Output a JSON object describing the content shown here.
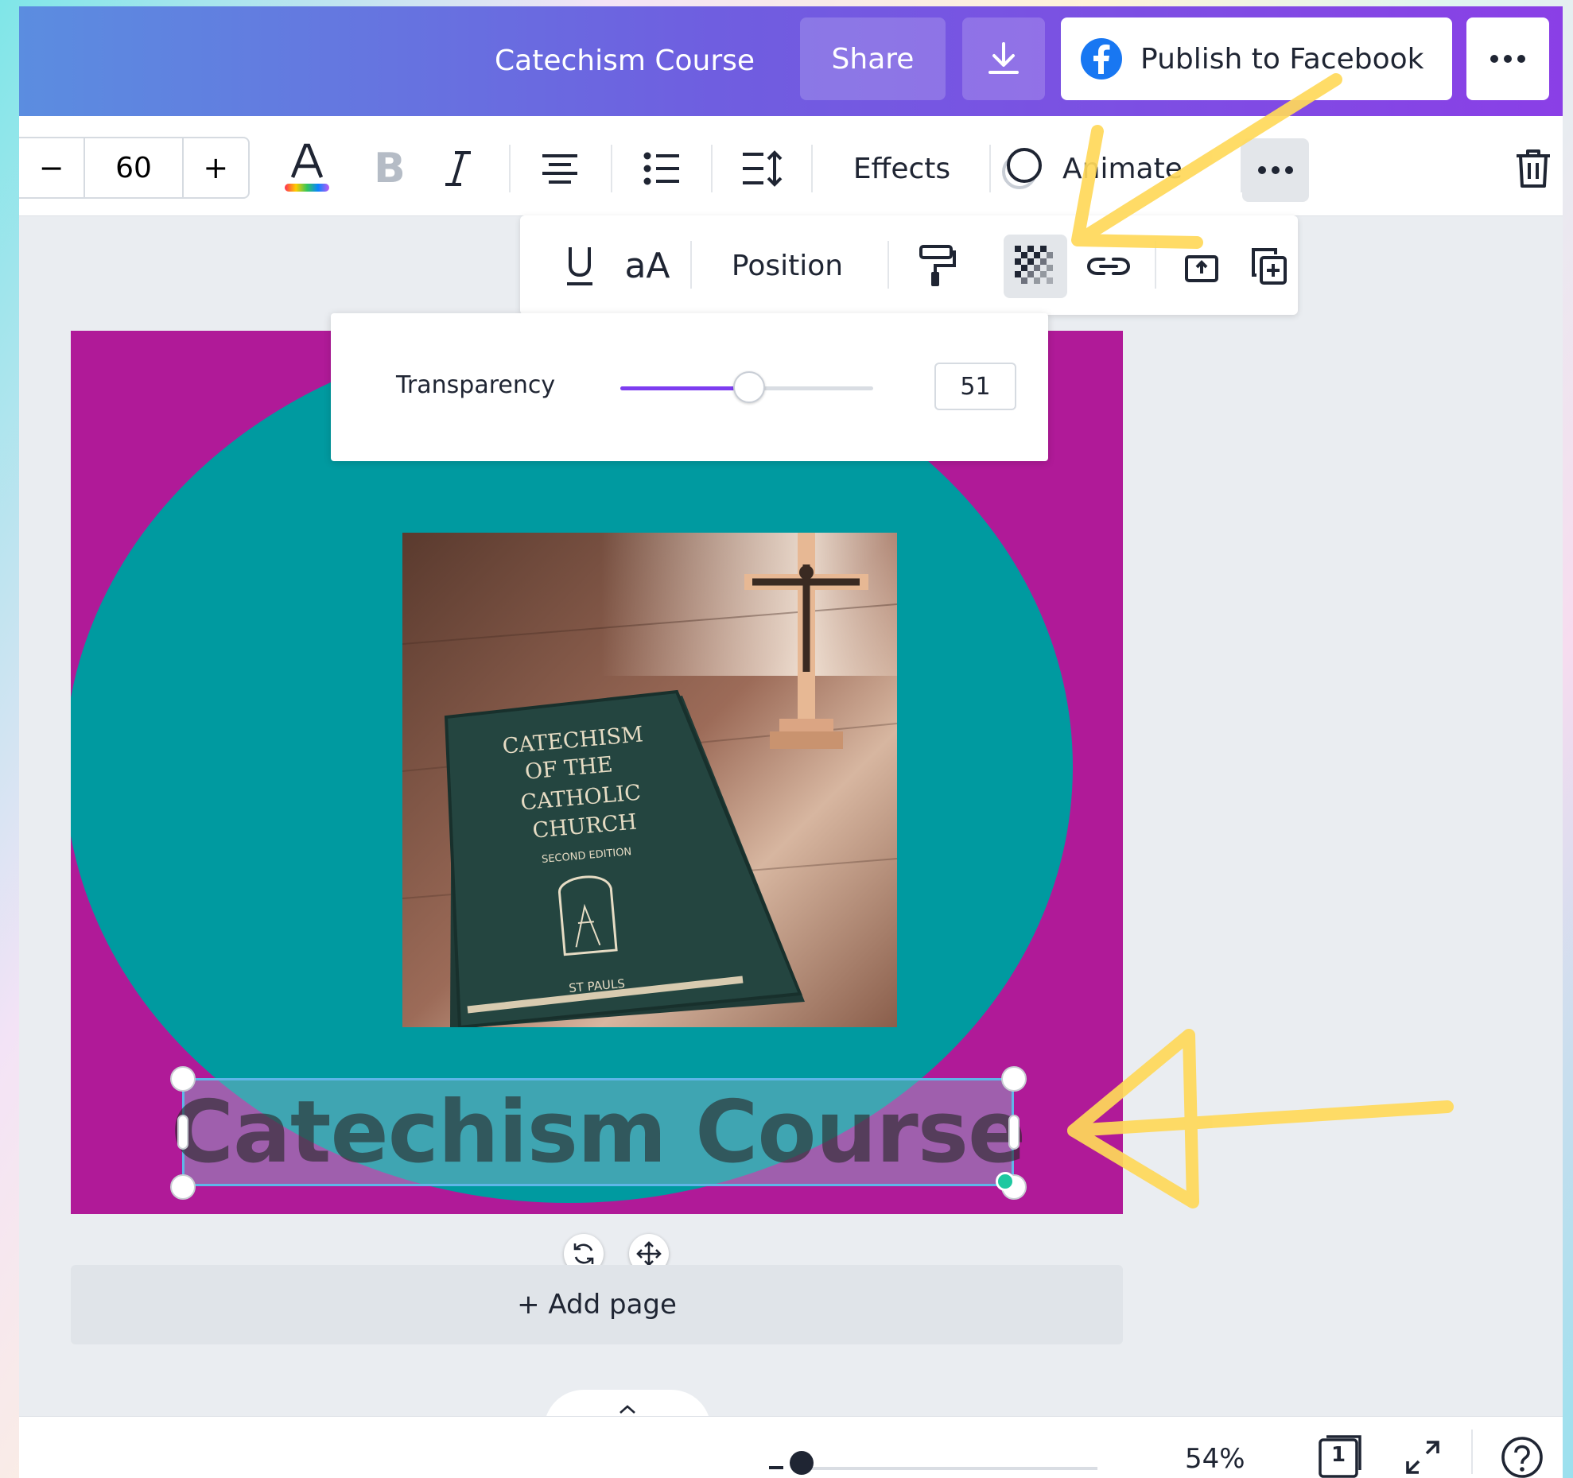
{
  "header": {
    "doc_title": "Catechism Course",
    "share_label": "Share",
    "publish_label": "Publish to Facebook"
  },
  "toolbar": {
    "font_size": "60",
    "minus": "−",
    "plus": "+",
    "effects_label": "Effects",
    "animate_label": "Animate"
  },
  "subbar": {
    "position_label": "Position"
  },
  "transparency": {
    "label": "Transparency",
    "value": "51",
    "percent": 51
  },
  "canvas": {
    "headline": "Catechism Course",
    "book_lines": [
      "CATECHISM",
      "OF THE",
      "CATHOLIC",
      "CHURCH"
    ],
    "book_edition": "SECOND EDITION",
    "book_publisher": "ST PAULS",
    "colors": {
      "background": "#b01a98",
      "circle": "#009aa0"
    }
  },
  "add_page_label": "+ Add page",
  "footer": {
    "zoom": "54%",
    "page_count": "1"
  },
  "icons": {
    "download": "download-icon",
    "facebook": "facebook-icon",
    "more": "more-icon",
    "text_color": "text-color-icon",
    "bold": "bold-icon",
    "italic": "italic-icon",
    "align": "align-center-icon",
    "list": "bullet-list-icon",
    "spacing": "line-spacing-icon",
    "animate": "animate-icon",
    "trash": "trash-icon",
    "underline": "underline-icon",
    "case": "case-icon",
    "paint": "paint-roller-icon",
    "transparency": "transparency-icon",
    "link": "link-icon",
    "lock": "lock-icon",
    "duplicate": "duplicate-icon",
    "rotate": "rotate-icon",
    "move": "move-icon",
    "expand": "expand-icon",
    "help": "help-icon"
  }
}
